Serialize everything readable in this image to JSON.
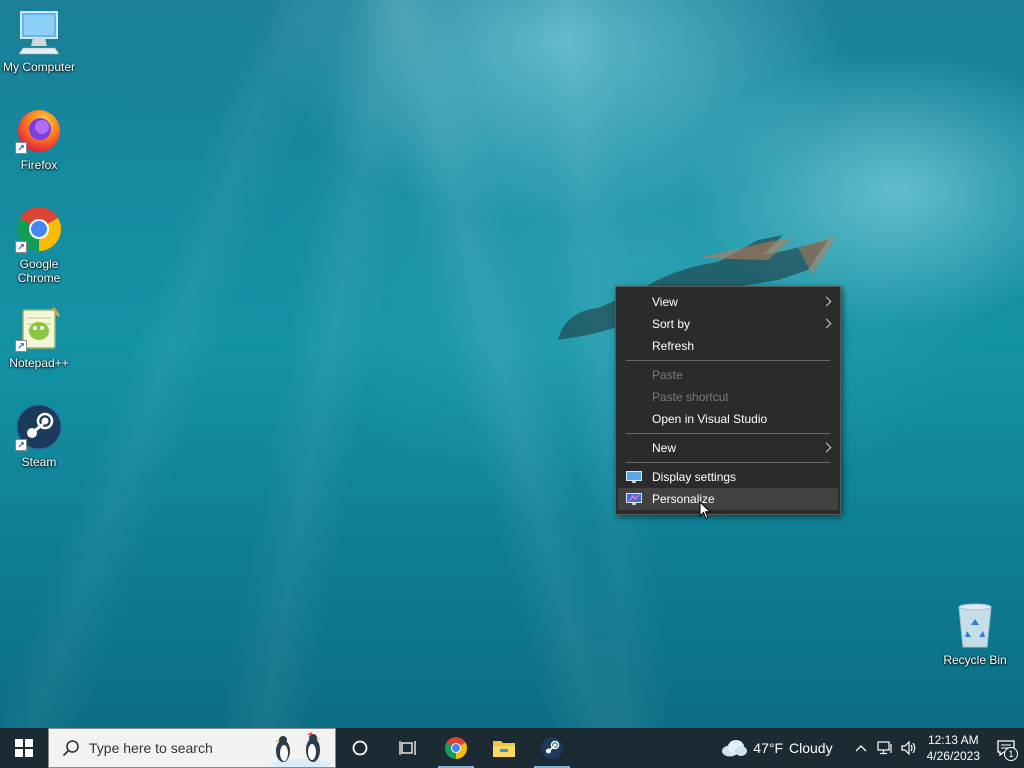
{
  "desktop": {
    "icons": [
      {
        "label": "My Computer",
        "icon": "computer-icon"
      },
      {
        "label": "Firefox",
        "icon": "firefox-icon"
      },
      {
        "label": "Google Chrome",
        "icon": "chrome-icon"
      },
      {
        "label": "Notepad++",
        "icon": "notepadpp-icon"
      },
      {
        "label": "Steam",
        "icon": "steam-icon"
      },
      {
        "label": "Recycle Bin",
        "icon": "recycle-bin-icon"
      }
    ]
  },
  "context_menu": {
    "items": [
      {
        "label": "View",
        "submenu": true,
        "enabled": true
      },
      {
        "label": "Sort by",
        "submenu": true,
        "enabled": true
      },
      {
        "label": "Refresh",
        "enabled": true
      },
      {
        "label": "Paste",
        "enabled": false
      },
      {
        "label": "Paste shortcut",
        "enabled": false
      },
      {
        "label": "Open in Visual Studio",
        "enabled": true
      },
      {
        "label": "New",
        "submenu": true,
        "enabled": true
      },
      {
        "label": "Display settings",
        "icon": "display-icon",
        "enabled": true
      },
      {
        "label": "Personalize",
        "icon": "personalize-icon",
        "enabled": true,
        "hovered": true
      }
    ]
  },
  "taskbar": {
    "search_placeholder": "Type here to search",
    "pinned": [
      "cortana-icon",
      "task-view-icon",
      "chrome-icon",
      "file-explorer-icon",
      "steam-icon"
    ],
    "weather": {
      "temp": "47°F",
      "condition": "Cloudy"
    },
    "clock": {
      "time": "12:13 AM",
      "date": "4/26/2023"
    },
    "notification_count": "1"
  }
}
